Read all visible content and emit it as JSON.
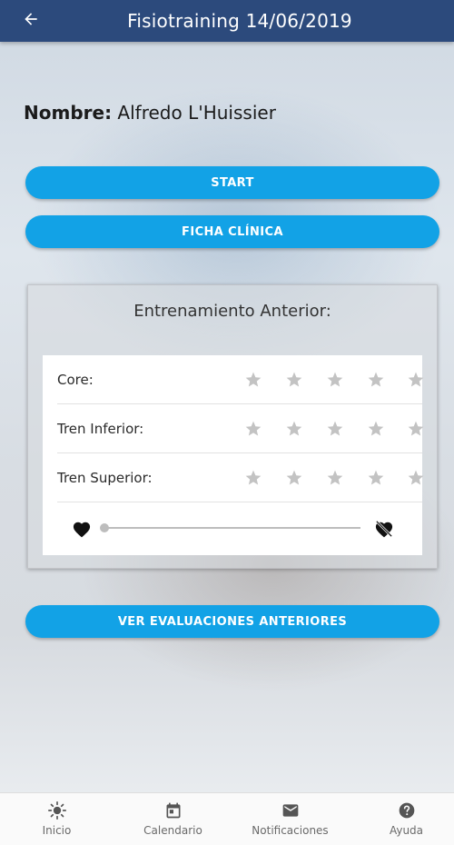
{
  "header": {
    "title": "Fisiotraining 14/06/2019",
    "back_icon": "arrow-left-icon"
  },
  "patient": {
    "name_label": "Nombre:",
    "name_value": "Alfredo L'Huissier"
  },
  "buttons": {
    "start": "START",
    "ficha": "FICHA CLÍNICA",
    "ver_evaluaciones": "VER EVALUACIONES ANTERIORES"
  },
  "previous_training": {
    "title": "Entrenamiento Anterior:",
    "ratings": [
      {
        "label": "Core:",
        "stars": 0,
        "max": 5
      },
      {
        "label": "Tren Inferior:",
        "stars": 0,
        "max": 5
      },
      {
        "label": "Tren Superior:",
        "stars": 0,
        "max": 5
      }
    ],
    "slider": {
      "value": 0,
      "min_icon": "heart-icon",
      "max_icon": "heart-broken-icon"
    }
  },
  "tabs": [
    {
      "label": "Inicio",
      "icon": "sun-icon"
    },
    {
      "label": "Calendario",
      "icon": "calendar-icon"
    },
    {
      "label": "Notificaciones",
      "icon": "mail-icon"
    },
    {
      "label": "Ayuda",
      "icon": "help-icon"
    }
  ],
  "colors": {
    "header": "#2c4a7c",
    "accent": "#12a2e6",
    "star_inactive": "#c3c3c3"
  }
}
